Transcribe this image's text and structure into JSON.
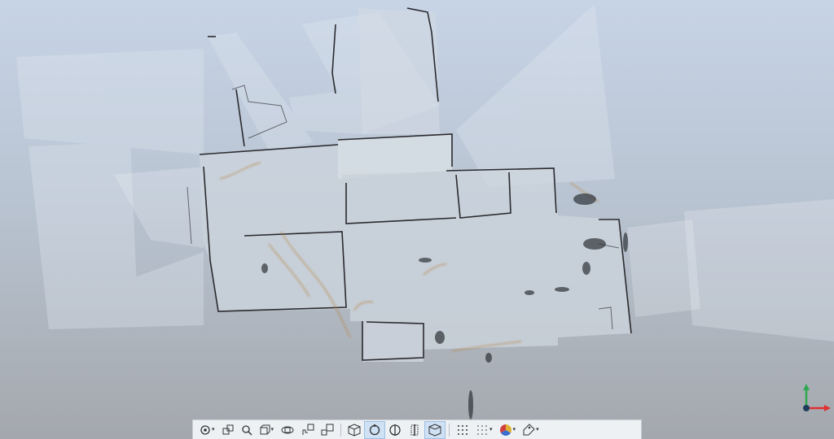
{
  "viewer": {
    "canvas": "point-cloud-3d-view",
    "background_colors": {
      "top": "#c7d4e6",
      "bottom": "#a4a8ad"
    }
  },
  "toolbar": {
    "buttons": [
      {
        "name": "view-options",
        "icon": "eye-dropdown-icon",
        "dropdown": true,
        "active": false
      },
      {
        "name": "orbit-view",
        "icon": "cube-orbit-icon",
        "dropdown": false,
        "active": false
      },
      {
        "name": "zoom",
        "icon": "magnifier-icon",
        "dropdown": false,
        "active": false
      },
      {
        "name": "projection",
        "icon": "box-projection-icon",
        "dropdown": true,
        "active": false
      },
      {
        "name": "rotate",
        "icon": "rotate-icon",
        "dropdown": false,
        "active": false
      },
      {
        "name": "pan-view",
        "icon": "hand-cube-icon",
        "dropdown": false,
        "active": false
      },
      {
        "name": "fit-view",
        "icon": "fit-cube-icon",
        "dropdown": false,
        "active": false
      },
      {
        "name": "3d-view",
        "icon": "cube-icon",
        "dropdown": false,
        "active": false
      },
      {
        "name": "orbit-mode",
        "icon": "orbit-circle-icon",
        "dropdown": false,
        "active": true
      },
      {
        "name": "section",
        "icon": "circle-split-icon",
        "dropdown": false,
        "active": false
      },
      {
        "name": "clip-plane",
        "icon": "clip-plane-icon",
        "dropdown": false,
        "active": false
      },
      {
        "name": "clip-box",
        "icon": "clip-box-icon",
        "dropdown": false,
        "active": true
      },
      {
        "name": "point-size",
        "icon": "dot-grid-icon",
        "dropdown": false,
        "active": false
      },
      {
        "name": "point-density",
        "icon": "dot-density-icon",
        "dropdown": true,
        "active": false
      },
      {
        "name": "color-mode",
        "icon": "color-wheel-icon",
        "dropdown": true,
        "active": false
      },
      {
        "name": "measure",
        "icon": "tag-measure-icon",
        "dropdown": true,
        "active": false
      }
    ]
  },
  "axis_indicator": {
    "x_color": "#e03030",
    "y_color": "#2fa84f",
    "z_color": "#2060e0"
  }
}
